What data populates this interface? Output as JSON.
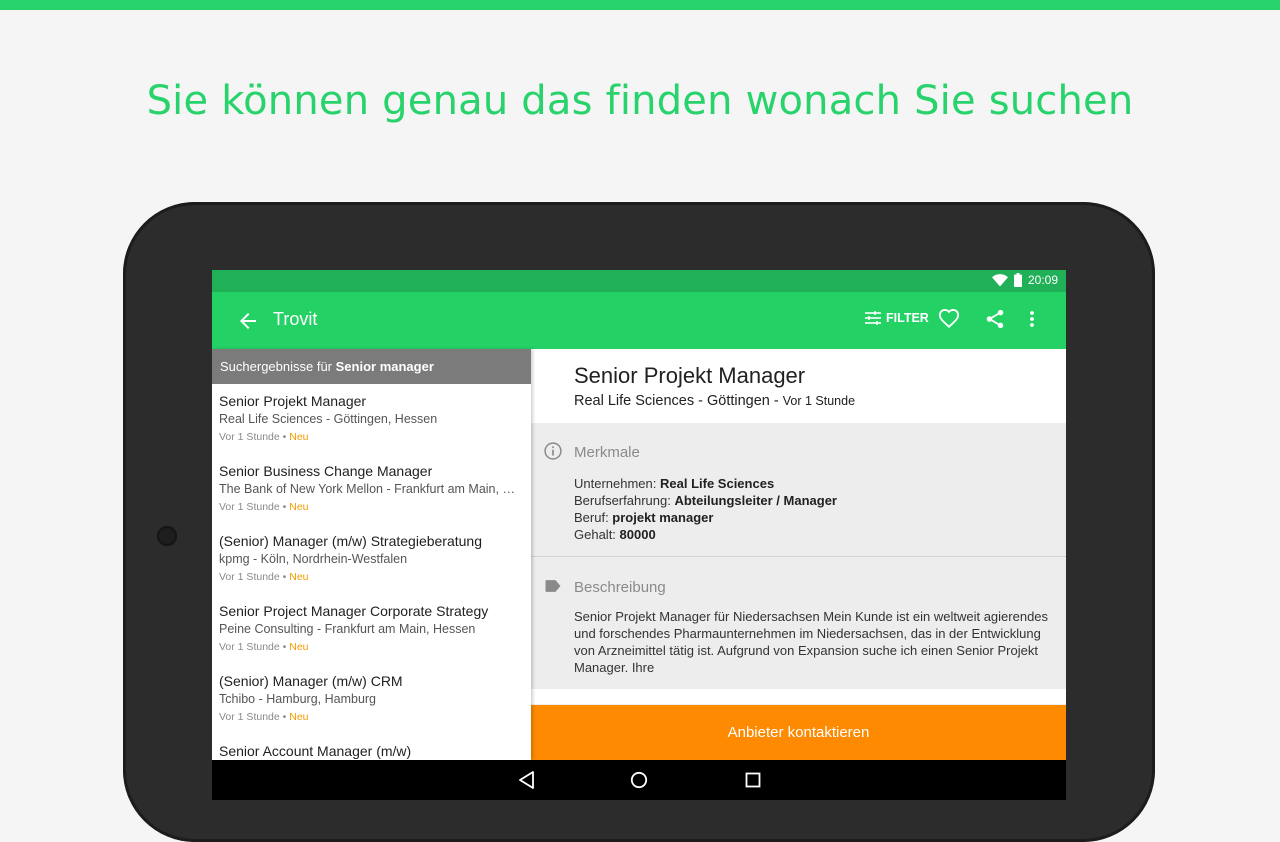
{
  "headline": "Sie können genau das finden wonach Sie suchen",
  "colors": {
    "brand_green": "#24d164",
    "status_green": "#1fb058",
    "accent_orange": "#fd8a00",
    "new_badge": "#f39a00"
  },
  "status_bar": {
    "time": "20:09",
    "icons": [
      "wifi-icon",
      "battery-icon"
    ]
  },
  "app_bar": {
    "title": "Trovit",
    "filter_label": "FILTER",
    "icons": [
      "back-arrow-icon",
      "sliders-icon",
      "heart-icon",
      "share-icon",
      "more-vert-icon"
    ]
  },
  "results": {
    "header_prefix": "Suchergebnisse für ",
    "header_query": "Senior manager",
    "items": [
      {
        "title": "Senior Projekt Manager",
        "company": "Real Life Sciences - Göttingen, Hessen",
        "time": "Vor 1 Stunde",
        "sep": " • ",
        "badge": "Neu"
      },
      {
        "title": "Senior Business Change Manager",
        "company": "The Bank of New York Mellon - Frankfurt am Main, Hessen",
        "time": "Vor 1 Stunde",
        "sep": " • ",
        "badge": "Neu"
      },
      {
        "title": "(Senior) Manager (m/w) Strategieberatung",
        "company": "kpmg - Köln, Nordrhein-Westfalen",
        "time": "Vor 1 Stunde",
        "sep": " • ",
        "badge": "Neu"
      },
      {
        "title": "Senior Project Manager Corporate Strategy",
        "company": "Peine Consulting - Frankfurt am Main, Hessen",
        "time": "Vor 1 Stunde",
        "sep": " • ",
        "badge": "Neu"
      },
      {
        "title": "(Senior) Manager (m/w) CRM",
        "company": "Tchibo - Hamburg, Hamburg",
        "time": "Vor 1 Stunde",
        "sep": " • ",
        "badge": "Neu"
      },
      {
        "title": "Senior Account Manager (m/w)",
        "company": "",
        "time": "",
        "sep": "",
        "badge": ""
      }
    ]
  },
  "detail": {
    "title": "Senior Projekt Manager",
    "subtitle": "Real Life Sciences - Göttingen",
    "sub_sep": " - ",
    "time": "Vor 1 Stunde",
    "features_label": "Merkmale",
    "features": [
      {
        "key": "Unternehmen: ",
        "value": "Real Life Sciences"
      },
      {
        "key": "Berufserfahrung: ",
        "value": "Abteilungsleiter / Manager"
      },
      {
        "key": "Beruf: ",
        "value": "projekt manager"
      },
      {
        "key": "Gehalt: ",
        "value": "80000"
      }
    ],
    "description_label": "Beschreibung",
    "description": "Senior Projekt Manager für Niedersachsen Mein Kunde ist ein weltweit agierendes und forschendes Pharmaunternehmen im Niedersachsen, das in der Entwicklung von Arzneimittel tätig ist. Aufgrund von Expansion suche ich einen Senior Projekt Manager. Ihre",
    "cta_label": "Anbieter kontaktieren"
  },
  "nav_bar": {
    "icons": [
      "nav-back-icon",
      "nav-home-icon",
      "nav-recents-icon"
    ]
  }
}
